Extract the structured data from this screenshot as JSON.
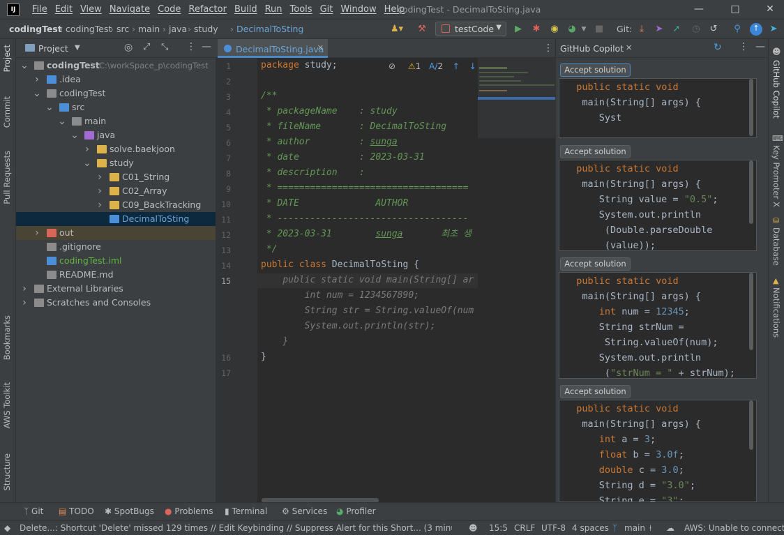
{
  "window": {
    "title": "codingTest - DecimalToSting.java",
    "menu": [
      "File",
      "Edit",
      "View",
      "Navigate",
      "Code",
      "Refactor",
      "Build",
      "Run",
      "Tools",
      "Git",
      "Window",
      "Help"
    ]
  },
  "breadcrumb": [
    "codingTest",
    "codingTest",
    "src",
    "main",
    "java",
    "study",
    "DecimalToSting"
  ],
  "toolbar": {
    "run_config": "testCode",
    "git_label": "Git:"
  },
  "project": {
    "title": "Project",
    "tree": [
      {
        "label": "codingTest",
        "path": "C:\\workSpace_p\\codingTest",
        "depth": 0,
        "arrow": "down",
        "icon": "foldg"
      },
      {
        "label": ".idea",
        "depth": 1,
        "arrow": "right",
        "icon": "foldb"
      },
      {
        "label": "codingTest",
        "depth": 1,
        "arrow": "down",
        "icon": "foldg"
      },
      {
        "label": "src",
        "depth": 2,
        "arrow": "down",
        "icon": "foldb"
      },
      {
        "label": "main",
        "depth": 3,
        "arrow": "down",
        "icon": "foldg"
      },
      {
        "label": "java",
        "depth": 4,
        "arrow": "down",
        "icon": "foldp"
      },
      {
        "label": "solve.baekjoon",
        "depth": 5,
        "arrow": "right",
        "icon": "fold"
      },
      {
        "label": "study",
        "depth": 5,
        "arrow": "down",
        "icon": "fold"
      },
      {
        "label": "C01_String",
        "depth": 6,
        "arrow": "right",
        "icon": "fold"
      },
      {
        "label": "C02_Array",
        "depth": 6,
        "arrow": "right",
        "icon": "fold"
      },
      {
        "label": "C09_BackTracking",
        "depth": 6,
        "arrow": "right",
        "icon": "fold"
      },
      {
        "label": "DecimalToSting",
        "depth": 6,
        "arrow": "",
        "icon": "foldb",
        "selected": true
      },
      {
        "label": "out",
        "depth": 1,
        "arrow": "right",
        "icon": "foldr",
        "hl": true
      },
      {
        "label": ".gitignore",
        "depth": 1,
        "arrow": "",
        "icon": "foldg"
      },
      {
        "label": "codingTest.iml",
        "depth": 1,
        "arrow": "",
        "icon": "foldb",
        "green": true
      },
      {
        "label": "README.md",
        "depth": 1,
        "arrow": "",
        "icon": "foldg"
      },
      {
        "label": "External Libraries",
        "depth": 0,
        "arrow": "right",
        "icon": "foldg"
      },
      {
        "label": "Scratches and Consoles",
        "depth": 0,
        "arrow": "right",
        "icon": "foldg"
      }
    ]
  },
  "left_tabs": [
    "Project",
    "Commit",
    "Pull Requests",
    "Bookmarks",
    "AWS Toolkit",
    "Structure"
  ],
  "editor": {
    "tab": "DecimalToSting.java",
    "warnings": "1",
    "weak": "2",
    "line_numbers": [
      "1",
      "2",
      "3",
      "4",
      "5",
      "6",
      "7",
      "8",
      "9",
      "10",
      "11",
      "12",
      "13",
      "14",
      "15",
      "",
      "",
      "",
      "",
      "16",
      "17"
    ]
  },
  "copilot": {
    "title": "GitHub Copilot",
    "accept_label": "Accept solution",
    "solutions": [
      "  public static void\n   main(String[] args) {\n      Syst",
      "  public static void\n   main(String[] args) {\n      String value = \"0.5\";\n      System.out.println\n       (Double.parseDouble\n       (value));",
      "  public static void\n   main(String[] args) {\n      int num = 12345;\n      String strNum =\n       String.valueOf(num);\n      System.out.println\n       (\"strNum = \" + strNum);",
      "  public static void\n   main(String[] args) {\n      int a = 3;\n      float b = 3.0f;\n      double c = 3.0;\n      String d = \"3.0\";\n      String e = \"3\";"
    ]
  },
  "right_tabs": [
    "GitHub Copilot",
    "Key Promoter X",
    "Database",
    "Notifications"
  ],
  "bottom_tabs": [
    "Git",
    "TODO",
    "SpotBugs",
    "Problems",
    "Terminal",
    "Services",
    "Profiler"
  ],
  "status": {
    "message": "Delete...: Shortcut 'Delete' missed 129 times // Edit Keybinding // Suppress Alert for this Short... (3 minutes ago)",
    "position": "15:5",
    "line_sep": "CRLF",
    "encoding": "UTF-8",
    "indent": "4 spaces",
    "branch": "main",
    "aws": "AWS: Unable to connect"
  }
}
